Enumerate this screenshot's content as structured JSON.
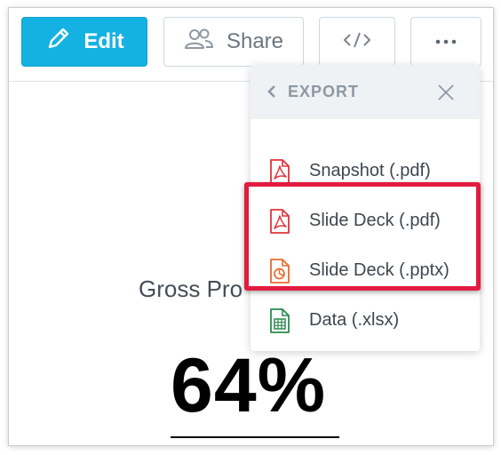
{
  "toolbar": {
    "edit_label": "Edit",
    "share_label": "Share",
    "embed_icon": "code-icon",
    "more_icon": "ellipsis-icon"
  },
  "kpi": {
    "title": "Gross Pro",
    "value": "64%"
  },
  "export_menu": {
    "title": "EXPORT",
    "items": [
      {
        "label": "Snapshot (.pdf)",
        "icon": "pdf-file-icon"
      },
      {
        "label": "Slide Deck (.pdf)",
        "icon": "pdf-file-icon"
      },
      {
        "label": "Slide Deck (.pptx)",
        "icon": "pptx-file-icon"
      },
      {
        "label": "Data (.xlsx)",
        "icon": "xlsx-file-icon"
      }
    ]
  },
  "colors": {
    "edit_button": "#14b2e2",
    "highlight": "#e21b40",
    "pdf_icon": "#e0333a",
    "pptx_icon": "#ea6a2c",
    "xlsx_icon": "#2c8a4f"
  }
}
